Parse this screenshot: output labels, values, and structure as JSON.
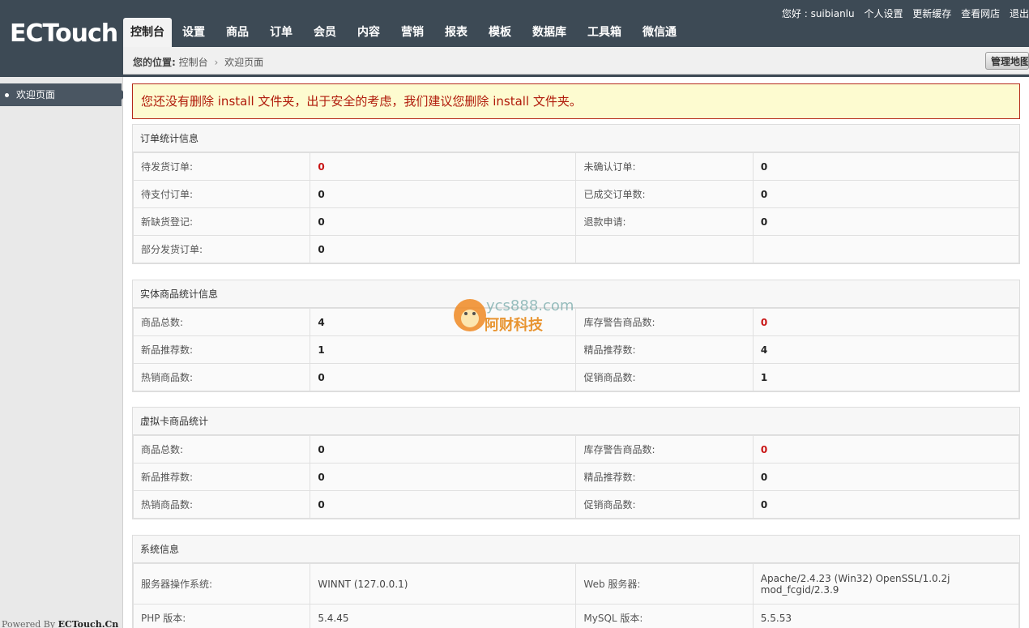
{
  "logo": {
    "text": "ECTouch"
  },
  "top_links": {
    "greeting": "您好 : suibianlu",
    "profile": "个人设置",
    "clear_cache": "更新缓存",
    "view_store": "查看网店",
    "logout": "退出"
  },
  "nav": {
    "items": [
      "控制台",
      "设置",
      "商品",
      "订单",
      "会员",
      "内容",
      "营销",
      "报表",
      "模板",
      "数据库",
      "工具箱",
      "微信通"
    ],
    "active_index": 0
  },
  "breadcrumb": {
    "label": "您的位置:",
    "home": "控制台",
    "current": "欢迎页面"
  },
  "sitemap_button": "管理地图",
  "sidebar": {
    "items": [
      {
        "label": "欢迎页面"
      }
    ],
    "powered_prefix": "Powered By",
    "powered_brand": "ECTouch.Cn"
  },
  "warning": "您还没有删除 install 文件夹，出于安全的考虑，我们建议您删除 install 文件夹。",
  "order_stats": {
    "title": "订单统计信息",
    "rows": [
      [
        {
          "label": "待发货订单:",
          "value": "0",
          "red": true
        },
        {
          "label": "未确认订单:",
          "value": "0"
        }
      ],
      [
        {
          "label": "待支付订单:",
          "value": "0"
        },
        {
          "label": "已成交订单数:",
          "value": "0"
        }
      ],
      [
        {
          "label": "新缺货登记:",
          "value": "0"
        },
        {
          "label": "退款申请:",
          "value": "0"
        }
      ],
      [
        {
          "label": "部分发货订单:",
          "value": "0"
        },
        {
          "label": "",
          "value": ""
        }
      ]
    ]
  },
  "goods_stats": {
    "title": "实体商品统计信息",
    "rows": [
      [
        {
          "label": "商品总数:",
          "value": "4"
        },
        {
          "label": "库存警告商品数:",
          "value": "0",
          "red": true
        }
      ],
      [
        {
          "label": "新品推荐数:",
          "value": "1"
        },
        {
          "label": "精品推荐数:",
          "value": "4"
        }
      ],
      [
        {
          "label": "热销商品数:",
          "value": "0"
        },
        {
          "label": "促销商品数:",
          "value": "1"
        }
      ]
    ]
  },
  "virtual_stats": {
    "title": "虚拟卡商品统计",
    "rows": [
      [
        {
          "label": "商品总数:",
          "value": "0"
        },
        {
          "label": "库存警告商品数:",
          "value": "0",
          "red": true
        }
      ],
      [
        {
          "label": "新品推荐数:",
          "value": "0"
        },
        {
          "label": "精品推荐数:",
          "value": "0"
        }
      ],
      [
        {
          "label": "热销商品数:",
          "value": "0"
        },
        {
          "label": "促销商品数:",
          "value": "0"
        }
      ]
    ]
  },
  "system_info": {
    "title": "系统信息",
    "rows": [
      [
        {
          "label": "服务器操作系统:",
          "value": "WINNT (127.0.0.1)"
        },
        {
          "label": "Web 服务器:",
          "value": "Apache/2.4.23 (Win32) OpenSSL/1.0.2j mod_fcgid/2.3.9"
        }
      ],
      [
        {
          "label": "PHP 版本:",
          "value": "5.4.45"
        },
        {
          "label": "MySQL 版本:",
          "value": "5.5.53"
        }
      ]
    ]
  },
  "watermark": {
    "text": "ycs888.com",
    "sub": "阿财科技"
  }
}
